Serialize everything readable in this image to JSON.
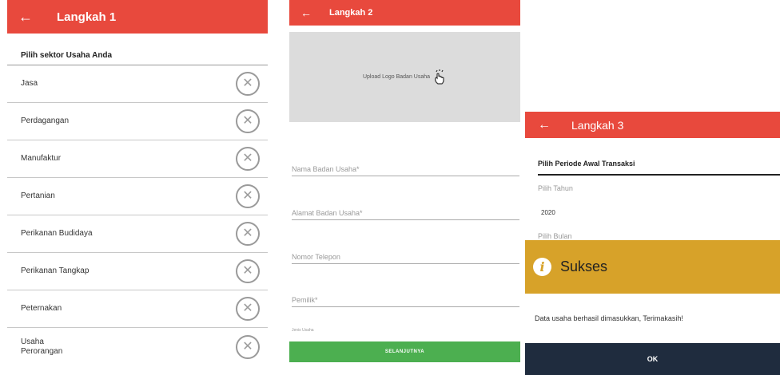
{
  "step1": {
    "back_icon": "arrow-left-icon",
    "title": "Langkah 1",
    "heading": "Pilih sektor Usaha Anda",
    "sectors": [
      {
        "label": "Jasa",
        "icon": "close-circle-icon"
      },
      {
        "label": "Perdagangan",
        "icon": "close-circle-icon"
      },
      {
        "label": "Manufaktur",
        "icon": "close-circle-icon"
      },
      {
        "label": "Pertanian",
        "icon": "close-circle-icon"
      },
      {
        "label": "Perikanan Budidaya",
        "icon": "close-circle-icon"
      },
      {
        "label": "Perikanan Tangkap",
        "icon": "close-circle-icon"
      },
      {
        "label": "Peternakan",
        "icon": "close-circle-icon"
      },
      {
        "label": "Usaha\nPerorangan",
        "icon": "close-circle-icon"
      }
    ]
  },
  "step2": {
    "back_icon": "arrow-left-icon",
    "title": "Langkah 2",
    "upload_text": "Upload Logo Badan Usaha",
    "upload_icon": "hand-tap-icon",
    "fields": {
      "name": "Nama Badan Usaha*",
      "address": "Alamat Badan Usaha*",
      "phone": "Nomor Telepon",
      "owner": "Pemilik*",
      "type": "Jenis Usaha"
    },
    "submit_label": "SELANJUTNYA"
  },
  "step3": {
    "back_icon": "arrow-left-icon",
    "title": "Langkah 3",
    "heading": "Pilih Periode Awal Transaksi",
    "year_label": "Pilih Tahun",
    "year_value": "2020",
    "month_label": "Pilih Bulan",
    "dialog": {
      "icon": "info-icon",
      "title": "Sukses",
      "message": "Data usaha berhasil dimasukkan, Terimakasih!",
      "ok_label": "OK"
    }
  },
  "colors": {
    "topbar": "#e8493d",
    "submit": "#4caf50",
    "dialog_header": "#d7a229",
    "dialog_ok": "#1f2c3e"
  }
}
